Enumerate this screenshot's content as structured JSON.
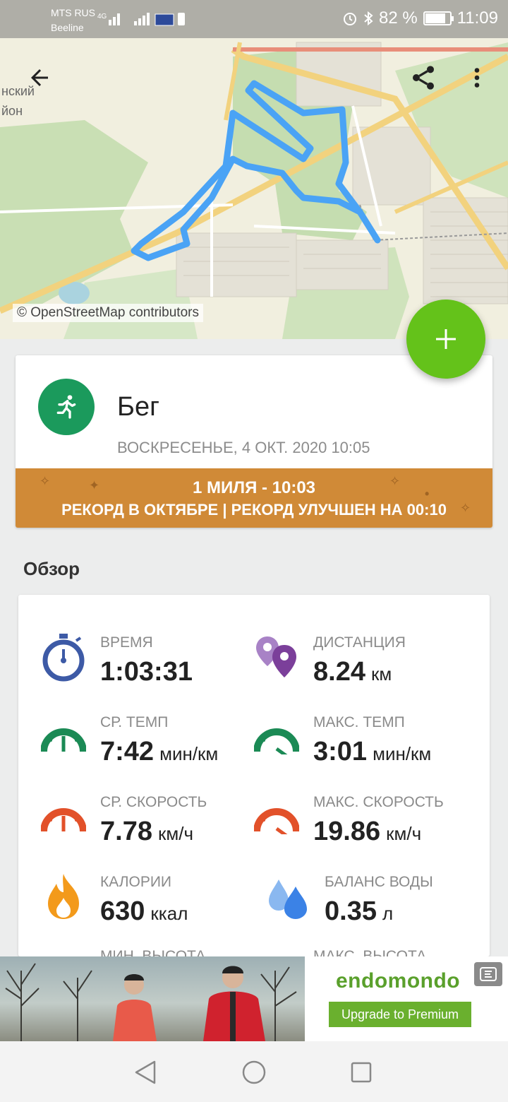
{
  "status_bar": {
    "carrier_1": "MTS RUS",
    "carrier_2": "Beeline",
    "network": "4G",
    "battery_text": "82 %",
    "battery_level": 0.82,
    "time": "11:09"
  },
  "map": {
    "credit": "© OpenStreetMap contributors",
    "place_label_1": "нский",
    "place_label_2": "йон",
    "route_color": "#4aa3f5"
  },
  "toolbar": {
    "back_icon": "arrow-back-icon",
    "share_icon": "share-icon",
    "more_icon": "more-vert-icon"
  },
  "fab": {
    "icon": "plus-icon",
    "color": "#64c21a"
  },
  "workout": {
    "sport_icon": "running-icon",
    "sport": "Бег",
    "date": "ВОСКРЕСЕНЬЕ, 4 ОКТ. 2020 10:05",
    "record": {
      "line1": "1 МИЛЯ  -  10:03",
      "line2": "РЕКОРД В ОКТЯБРЕ  |  РЕКОРД УЛУЧШЕН НА 00:10",
      "color": "#d08a37"
    }
  },
  "overview": {
    "title": "Обзор",
    "stats": [
      {
        "label": "ВРЕМЯ",
        "value": "1:03:31",
        "unit": "",
        "icon": "stopwatch-icon"
      },
      {
        "label": "ДИСТАНЦИЯ",
        "value": "8.24",
        "unit": "км",
        "icon": "distance-pin-icon"
      },
      {
        "label": "СР. ТЕМП",
        "value": "7:42",
        "unit": "мин/км",
        "icon": "avg-pace-gauge-icon"
      },
      {
        "label": "МАКС. ТЕМП",
        "value": "3:01",
        "unit": "мин/км",
        "icon": "max-pace-gauge-icon"
      },
      {
        "label": "СР. СКОРОСТЬ",
        "value": "7.78",
        "unit": "км/ч",
        "icon": "avg-speed-gauge-icon"
      },
      {
        "label": "МАКС. СКОРОСТЬ",
        "value": "19.86",
        "unit": "км/ч",
        "icon": "max-speed-gauge-icon"
      },
      {
        "label": "КАЛОРИИ",
        "value": "630",
        "unit": "ккал",
        "icon": "flame-icon"
      },
      {
        "label": "БАЛАНС ВОДЫ",
        "value": "0.35",
        "unit": "л",
        "icon": "water-drops-icon"
      }
    ],
    "partial_labels": [
      "МИН. ВЫСОТА",
      "МАКС. ВЫСОТА"
    ]
  },
  "ad": {
    "brand": "endomondo",
    "cta": "Upgrade to Premium",
    "close_icon": "ad-close-icon"
  },
  "nav_bar": {
    "back_icon": "nav-back-icon",
    "home_icon": "nav-home-icon",
    "recents_icon": "nav-recents-icon"
  }
}
